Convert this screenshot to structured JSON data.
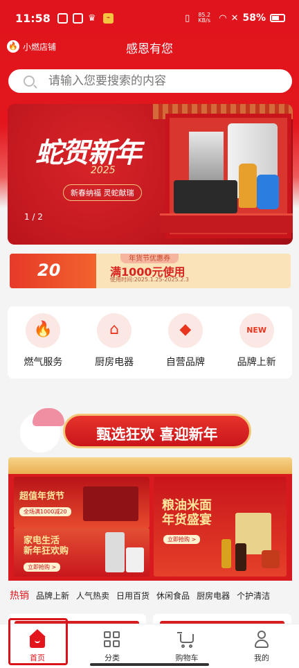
{
  "status": {
    "time": "11:58",
    "net_speed": "85.2 KB/s",
    "battery": "58%",
    "left_icons": [
      "app-icon",
      "box-icon",
      "crown-icon",
      "tag-icon"
    ]
  },
  "header": {
    "store_name": "小燃店铺",
    "title": "感恩有您"
  },
  "search": {
    "placeholder": "请输入您要搜索的内容"
  },
  "banner": {
    "slogan": "蛇贺新年",
    "year": "2025",
    "tagline": "新春纳福 灵蛇献瑞",
    "pager": "1 / 2"
  },
  "coupon": {
    "header": "年货节优惠券",
    "amount": "20",
    "condition": "满1000元使用",
    "validity": "使用时间:2025.1.25-2025.2.3"
  },
  "categories": [
    {
      "label": "燃气服务",
      "icon": "flame-icon"
    },
    {
      "label": "厨房电器",
      "icon": "range-hood-icon"
    },
    {
      "label": "自营品牌",
      "icon": "diamond-icon"
    },
    {
      "label": "品牌上新",
      "icon": "new-badge-icon"
    }
  ],
  "promo": {
    "headline": "甄选狂欢 喜迎新年",
    "tiles": [
      {
        "title": "超值年货节",
        "button": "全场满1000减20"
      },
      {
        "title": "家电生活\n新年狂欢购",
        "button": "立即抢购 >"
      },
      {
        "title": "粮油米面\n年货盛宴",
        "button": "立即抢购 >"
      }
    ]
  },
  "tabs": [
    "热销",
    "品牌上新",
    "人气热卖",
    "日用百货",
    "休闲食品",
    "厨房电器",
    "个护清洁"
  ],
  "bottom_nav": [
    {
      "label": "首页",
      "icon": "home-icon",
      "active": true
    },
    {
      "label": "分类",
      "icon": "category-icon",
      "active": false
    },
    {
      "label": "购物车",
      "icon": "cart-icon",
      "active": false
    },
    {
      "label": "我的",
      "icon": "user-icon",
      "active": false
    }
  ],
  "colors": {
    "brand_red": "#e3161d",
    "accent_gold": "#f4c778",
    "coupon_bg": "#fbe3b9"
  }
}
